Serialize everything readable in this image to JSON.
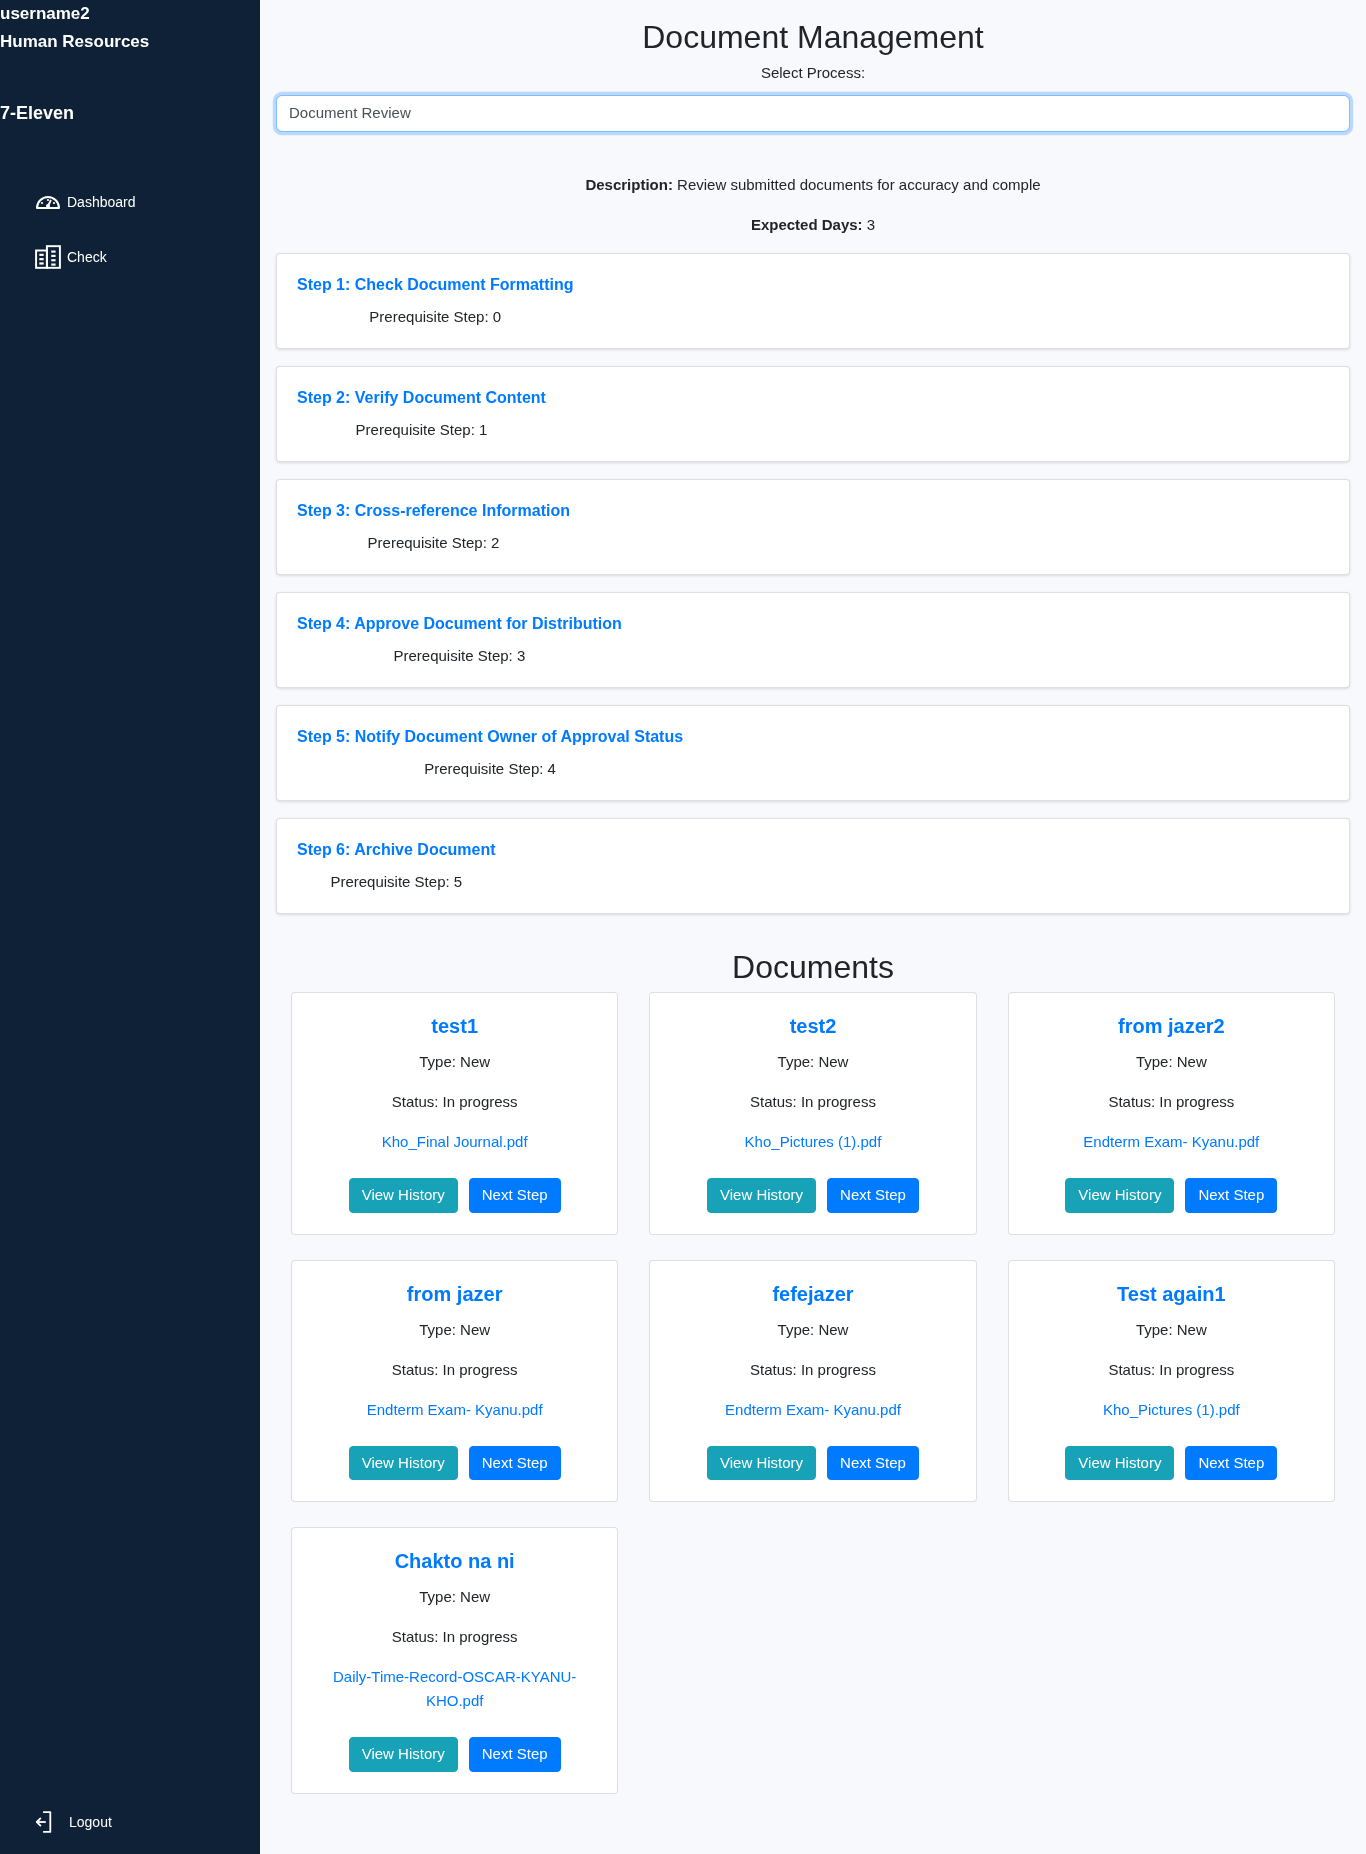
{
  "sidebar": {
    "username": "username2",
    "department": "Human Resources",
    "company": "7-Eleven",
    "items": [
      {
        "label": "Dashboard"
      },
      {
        "label": "Check"
      }
    ],
    "logout": "Logout"
  },
  "header": {
    "title": "Document Management",
    "process_select": {
      "label": "Select Process:",
      "value": "Document Review",
      "focused": true
    }
  },
  "process": {
    "description": "**Description:** Review submitted documents for accuracy and comple",
    "expected_days": "**Expected Days:** 3"
  },
  "steps": [
    {
      "title": "Step 1: Check Document Formatting",
      "prerequisite": "Prerequisite Step: 0"
    },
    {
      "title": "Step 2: Verify Document Content",
      "prerequisite": "Prerequisite Step: 1"
    },
    {
      "title": "Step 3: Cross-reference Information",
      "prerequisite": "Prerequisite Step: 2"
    },
    {
      "title": "Step 4: Approve Document for Distribution",
      "prerequisite": "Prerequisite Step: 3"
    },
    {
      "title": "Step 5: Notify Document Owner of Approval Status",
      "prerequisite": "Prerequisite Step: 4"
    },
    {
      "title": "Step 6: Archive Document",
      "prerequisite": "Prerequisite Step: 5"
    }
  ],
  "documents": {
    "title": "Documents",
    "items": [
      {
        "name": "test1",
        "type": "Type: New",
        "status": "Status: In progress",
        "file": "Kho_Final Journal.pdf",
        "buttons": [
          {
            "label": "View History",
            "kind": "history"
          },
          {
            "label": "Next Step",
            "kind": "next"
          }
        ]
      },
      {
        "name": "test2",
        "type": "Type: New",
        "status": "Status: In progress",
        "file": "Kho_Pictures (1).pdf",
        "buttons": [
          {
            "label": "View History",
            "kind": "history"
          },
          {
            "label": "Next Step",
            "kind": "next"
          }
        ]
      },
      {
        "name": "from jazer2",
        "type": "Type: New",
        "status": "Status: In progress",
        "file": "Endterm Exam- Kyanu.pdf",
        "buttons": [
          {
            "label": "View History",
            "kind": "history"
          },
          {
            "label": "Next Step",
            "kind": "next"
          }
        ]
      },
      {
        "name": "from jazer",
        "type": "Type: New",
        "status": "Status: In progress",
        "file": "Endterm Exam- Kyanu.pdf",
        "buttons": [
          {
            "label": "View History",
            "kind": "history"
          },
          {
            "label": "Next Step",
            "kind": "next"
          }
        ]
      },
      {
        "name": "fefejazer",
        "type": "Type: New",
        "status": "Status: In progress",
        "file": "Endterm Exam- Kyanu.pdf",
        "buttons": [
          {
            "label": "View History",
            "kind": "history"
          },
          {
            "label": "Next Step",
            "kind": "next"
          }
        ]
      },
      {
        "name": "Test again1",
        "type": "Type: New",
        "status": "Status: In progress",
        "file": "Kho_Pictures (1).pdf",
        "buttons": [
          {
            "label": "View History",
            "kind": "history"
          },
          {
            "label": "Next Step",
            "kind": "next"
          }
        ]
      },
      {
        "name": "Chakto na ni",
        "type": "Type: New",
        "status": "Status: In progress",
        "file": "Daily-Time-Record-OSCAR-KYANU-KHO.pdf",
        "buttons": [
          {
            "label": "View History",
            "kind": "history"
          },
          {
            "label": "Next Step",
            "kind": "next"
          }
        ]
      }
    ]
  }
}
